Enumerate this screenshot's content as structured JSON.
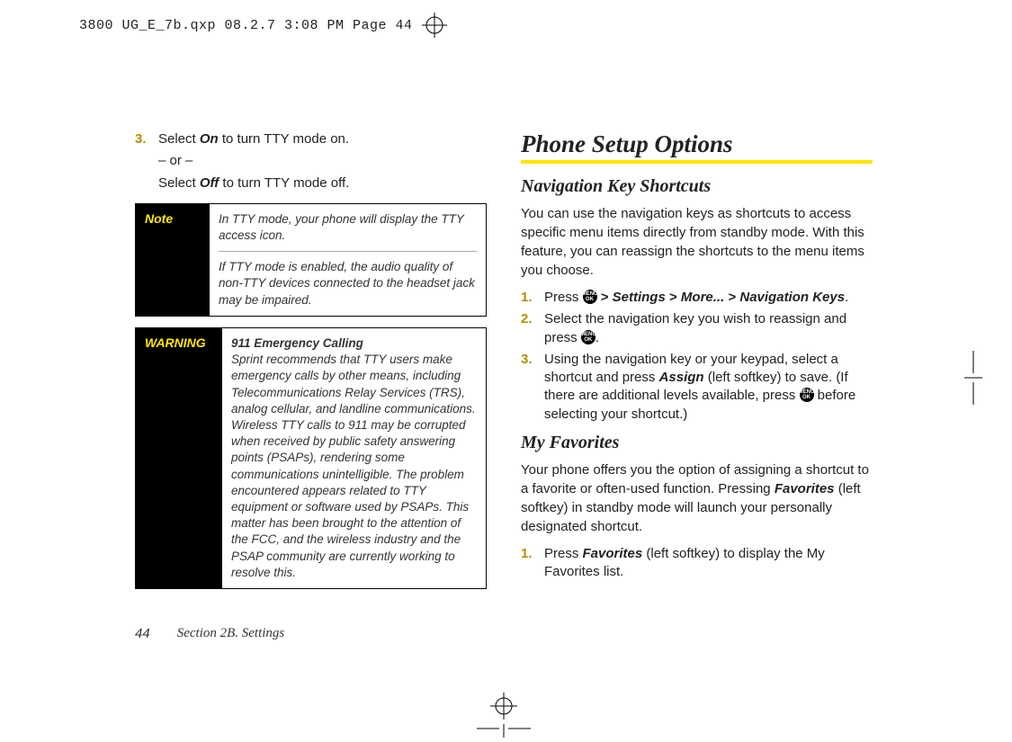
{
  "slug_text": "3800 UG_E_7b.qxp  08.2.7  3:08 PM  Page 44",
  "left": {
    "step3_num": "3.",
    "step3_a": "Select ",
    "step3_on": "On",
    "step3_b": " to turn TTY mode on.",
    "step3_or": "– or –",
    "step3_c": "Select ",
    "step3_off": "Off",
    "step3_d": " to turn TTY mode off.",
    "note_label": "Note",
    "note_p1": "In TTY mode, your phone will display the TTY access icon.",
    "note_p2": "If TTY mode is enabled, the audio quality of non-TTY devices connected to the headset jack may be impaired.",
    "warn_label": "WARNING",
    "warn_title": "911 Emergency Calling",
    "warn_body": "Sprint recommends that TTY users make emergency calls by other means, including Telecommunications Relay Services (TRS), analog cellular, and landline communications. Wireless TTY calls to 911 may be corrupted when received by public safety answering points (PSAPs), rendering some communications unintelligible. The problem encountered appears related to TTY equipment or software used by PSAPs. This matter has been brought to the attention of the FCC, and the wireless industry and the PSAP community are currently working to resolve this."
  },
  "right": {
    "h1": "Phone Setup Options",
    "h2a": "Navigation Key Shortcuts",
    "p1": "You can use the navigation keys as shortcuts to access specific menu items directly from standby mode. With this feature, you can reassign the shortcuts to the menu items you choose.",
    "s1_num": "1.",
    "s1_a": "Press ",
    "s1_path1": "Settings",
    "s1_path2": "More...",
    "s1_path3": "Navigation Keys",
    "s2_num": "2.",
    "s2_a": "Select the navigation key you wish to reassign and press ",
    "s3_num": "3.",
    "s3_a": "Using the navigation key or your keypad, select a shortcut and press ",
    "s3_assign": "Assign",
    "s3_b": " (left softkey) to save. (If there are additional levels available, press ",
    "s3_c": " before selecting your shortcut.)",
    "h2b": "My Favorites",
    "p2a": "Your phone offers you the option of assigning a shortcut to a favorite or often-used function. Pressing ",
    "p2_fav": "Favorites",
    "p2b": " (left softkey) in standby mode will launch your personally designated shortcut.",
    "f1_num": "1.",
    "f1_a": "Press ",
    "f1_fav": "Favorites",
    "f1_b": " (left softkey) to display the My Favorites list."
  },
  "menu_icon_label": "MENU OK",
  "footer_page": "44",
  "footer_section": "Section 2B. Settings"
}
